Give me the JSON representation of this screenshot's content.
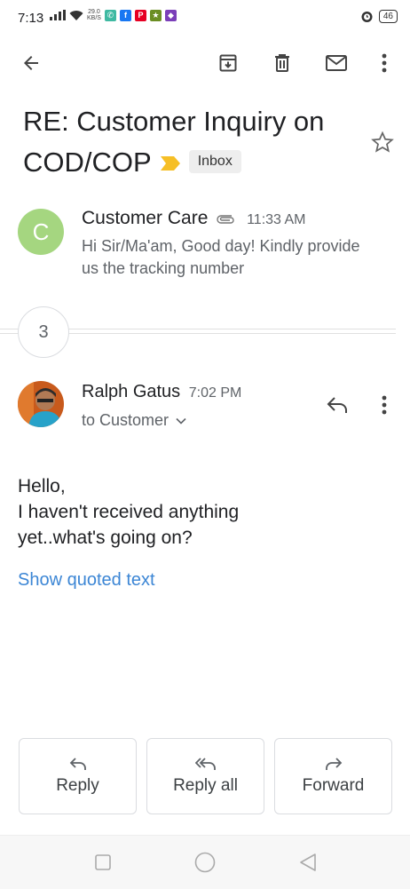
{
  "status_bar": {
    "time": "7:13",
    "net_speed_value": "29.0",
    "net_speed_unit": "KB/S",
    "battery": "46"
  },
  "toolbar": {
    "back_icon": "arrow-left-icon",
    "archive_icon": "archive-icon",
    "delete_icon": "trash-icon",
    "mark_unread_icon": "mail-icon",
    "more_icon": "more-vert-icon"
  },
  "thread": {
    "subject": "RE: Customer Inquiry on COD/COP",
    "label": "Inbox",
    "importance_color": "#f6bf26",
    "collapsed_count": "3"
  },
  "first_message": {
    "avatar_letter": "C",
    "avatar_color": "#a5d680",
    "sender": "Customer Care",
    "time": "11:33 AM",
    "snippet": "Hi Sir/Ma'am, Good day! Kindly provide us the tracking number"
  },
  "open_message": {
    "sender": "Ralph Gatus",
    "time": "7:02 PM",
    "to_text": "to Customer",
    "body_lines": [
      "Hello,",
      "I haven't received anything",
      "yet..what's going on?"
    ],
    "show_quoted": "Show quoted text"
  },
  "actions": {
    "reply": "Reply",
    "reply_all": "Reply all",
    "forward": "Forward"
  },
  "accent_link_color": "#3c86d5"
}
